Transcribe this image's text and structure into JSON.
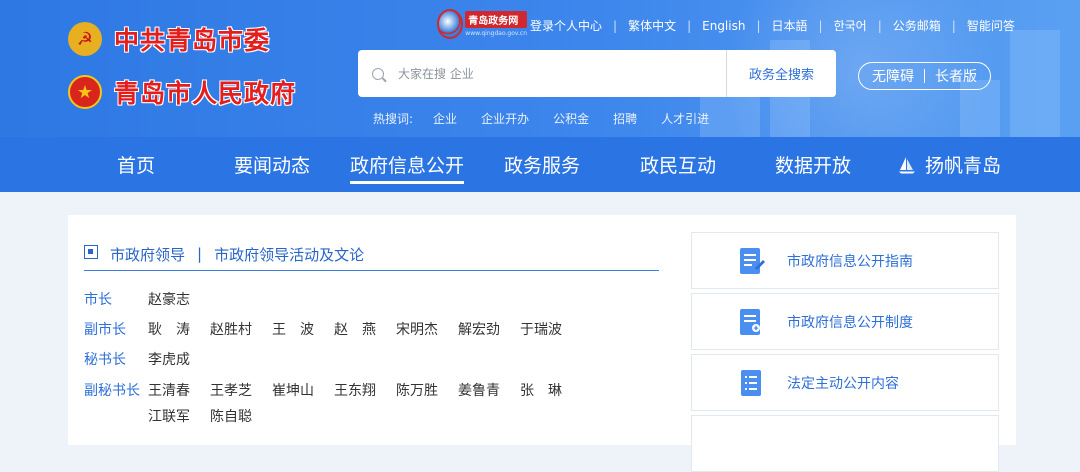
{
  "header": {
    "brand_party": "中共青岛市委",
    "brand_gov": "青岛市人民政府",
    "site_logo_title": "青岛政务网",
    "site_logo_url": "www.qingdao.gov.cn",
    "top_links": [
      "登录个人中心",
      "繁体中文",
      "English",
      "日本語",
      "한국어",
      "公务邮箱",
      "智能问答"
    ],
    "search": {
      "placeholder": "大家在搜 企业",
      "button": "政务全搜索"
    },
    "hot": {
      "label": "热搜词:",
      "items": [
        "企业",
        "企业开办",
        "公积金",
        "招聘",
        "人才引进"
      ]
    },
    "access": {
      "accessible": "无障碍",
      "elder": "长者版"
    }
  },
  "nav": {
    "items": [
      "首页",
      "要闻动态",
      "政府信息公开",
      "政务服务",
      "政民互动",
      "数据开放",
      "扬帆青岛"
    ],
    "active_index": 2
  },
  "leaders": {
    "heading_main": "市政府领导",
    "heading_sep": "|",
    "heading_sub": "市政府领导活动及文论",
    "rows": [
      {
        "role": "市长",
        "names": [
          "赵豪志"
        ]
      },
      {
        "role": "副市长",
        "names": [
          "耿　涛",
          "赵胜村",
          "王　波",
          "赵　燕",
          "宋明杰",
          "解宏劲",
          "于瑞波"
        ]
      },
      {
        "role": "秘书长",
        "names": [
          "李虎成"
        ]
      },
      {
        "role": "副秘书长",
        "names": [
          "王清春",
          "王孝芝",
          "崔坤山",
          "王东翔",
          "陈万胜",
          "姜鲁青",
          "张　琳",
          "江联军",
          "陈自聪"
        ]
      }
    ]
  },
  "side": {
    "items": [
      {
        "label": "市政府信息公开指南",
        "icon": "guide-doc-icon"
      },
      {
        "label": "市政府信息公开制度",
        "icon": "policy-doc-icon"
      },
      {
        "label": "法定主动公开内容",
        "icon": "list-doc-icon"
      }
    ]
  },
  "colors": {
    "header_blue": "#2e78e4",
    "nav_blue": "#2b74e3",
    "link_blue": "#2e6fd8",
    "brand_red": "#e41d1d"
  }
}
